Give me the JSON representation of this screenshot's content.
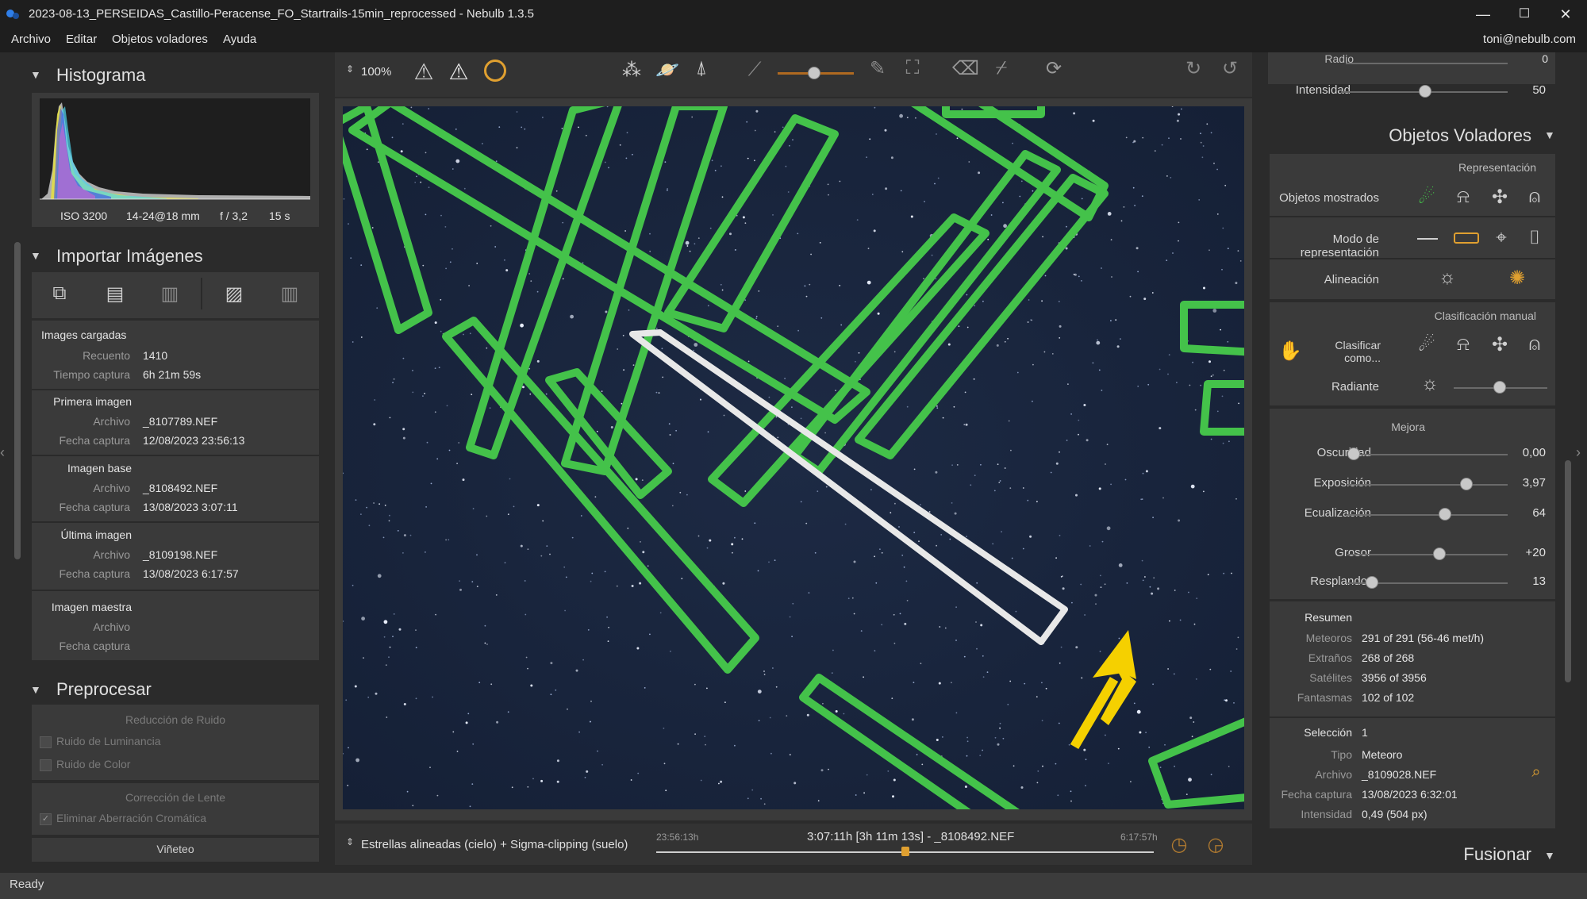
{
  "window": {
    "title": "2023-08-13_PERSEIDAS_Castillo-Peracense_FO_Startrails-15min_reprocessed - Nebulb 1.3.5",
    "controls": [
      "—",
      "☐",
      "✕"
    ]
  },
  "menu": [
    "Archivo",
    "Editar",
    "Objetos voladores",
    "Ayuda"
  ],
  "user": "toni@nebulb.com",
  "histogram": {
    "title": "Histograma",
    "iso": "ISO 3200",
    "lens": "14-24@18 mm",
    "aperture": "f / 3,2",
    "exposure": "15 s"
  },
  "import": {
    "title": "Importar Imágenes",
    "loaded_title": "Images cargadas",
    "count_label": "Recuento",
    "count_value": "1410",
    "capture_time_label": "Tiempo captura",
    "capture_time_value": "6h 21m 59s",
    "first": {
      "title": "Primera imagen",
      "file_label": "Archivo",
      "file": "_8107789.NEF",
      "date_label": "Fecha captura",
      "date": "12/08/2023 23:56:13"
    },
    "base": {
      "title": "Imagen base",
      "file_label": "Archivo",
      "file": "_8108492.NEF",
      "date_label": "Fecha captura",
      "date": "13/08/2023 3:07:11"
    },
    "last": {
      "title": "Última imagen",
      "file_label": "Archivo",
      "file": "_8109198.NEF",
      "date_label": "Fecha captura",
      "date": "13/08/2023 6:17:57"
    },
    "master": {
      "title": "Imagen maestra",
      "file_label": "Archivo",
      "date_label": "Fecha captura"
    }
  },
  "preprocess": {
    "title": "Preprocesar",
    "noise_title": "Reducción de Ruido",
    "luminance": "Ruido de Luminancia",
    "color": "Ruido de Color",
    "lens_title": "Corrección de Lente",
    "chromatic": "Eliminar Aberración Cromática",
    "vignette": "Viñeteo"
  },
  "toolbar": {
    "zoom": "100%"
  },
  "timeline": {
    "mode": "Estrellas alineadas (cielo) + Sigma-clipping (suelo)",
    "start": "23:56:13h",
    "current": "3:07:11h [3h 11m 13s] - _8108492.NEF",
    "end": "6:17:57h",
    "position": 0.5
  },
  "right": {
    "radio_label": "Radio",
    "radio_value": "0",
    "intensity_label": "Intensidad",
    "intensity_value": "50",
    "flying_title": "Objetos Voladores",
    "representation_title": "Representación",
    "shown_label": "Objetos mostrados",
    "mode_label": "Modo de representación",
    "align_label": "Alineación",
    "manual_title": "Clasificación manual",
    "classify_label": "Clasificar como...",
    "radiant_label": "Radiante",
    "improve_title": "Mejora",
    "sliders": [
      {
        "label": "Oscuridad",
        "value": "0,00",
        "level": 0.0
      },
      {
        "label": "Exposición",
        "value": "3,97",
        "level": 0.79
      },
      {
        "label": "Ecualización",
        "value": "64",
        "level": 0.64
      },
      {
        "label": "Grosor",
        "value": "+20",
        "level": 0.6
      },
      {
        "label": "Resplandor",
        "value": "13",
        "level": 0.13
      }
    ],
    "summary_title": "Resumen",
    "summary": [
      {
        "label": "Meteoros",
        "value": "291 of 291 (56-46 met/h)"
      },
      {
        "label": "Extraños",
        "value": "268 of 268"
      },
      {
        "label": "Satélites",
        "value": "3956 of 3956"
      },
      {
        "label": "Fantasmas",
        "value": "102 of 102"
      }
    ],
    "selection_label": "Selección",
    "selection_value": "1",
    "selection": [
      {
        "label": "Tipo",
        "value": "Meteoro"
      },
      {
        "label": "Archivo",
        "value": "_8109028.NEF"
      },
      {
        "label": "Fecha captura",
        "value": "13/08/2023 6:32:01"
      },
      {
        "label": "Intensidad",
        "value": "0,49 (504 px)"
      }
    ],
    "merge_title": "Fusionar"
  },
  "status": "Ready",
  "colors": {
    "highlight": "#44c24a",
    "selected": "#e8e8e8",
    "arrow": "#f5d000",
    "accent": "#e0a030"
  }
}
